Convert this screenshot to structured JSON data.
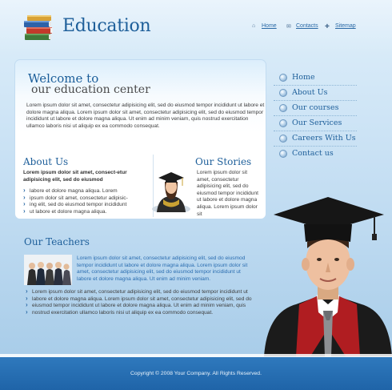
{
  "header": {
    "logo_text": "Education",
    "nav": [
      {
        "label": "Home",
        "icon": "home-icon"
      },
      {
        "label": "Contacts",
        "icon": "envelope-icon"
      },
      {
        "label": "Sitemap",
        "icon": "sitemap-icon"
      }
    ]
  },
  "welcome": {
    "title_line1": "Welcome to",
    "title_line2": "our education center",
    "paragraph": "Lorem ipsum dolor sit amet, consectetur adipisicing elit, sed do eiusmod tempor incididunt ut labore et dolore magna aliqua. Lorem ipsum dolor sit amet, consectetur adipisicing elit, sed do eiusmod tempor incididunt ut labore et dolore magna aliqua. Ut enim ad minim veniam, quis nostrud exercitation ullamco laboris nisi ut aliquip ex ea commodo consequat."
  },
  "about": {
    "heading": "About Us",
    "bold_text": "Lorem ipsum dolor sit amet, consect-etur adipisicing elit, sed do eiusmod",
    "items": [
      "labore et dolore magna aliqua. Lorem",
      "ipsum dolor sit amet, consectetur adipisic-",
      "ing elit, sed do eiusmod tempor incididunt",
      "ut labore et dolore magna aliqua."
    ]
  },
  "stories": {
    "heading": "Our Stories",
    "text": "Lorem ipsum dolor sit amet, consectetur adipisicing elit, sed do eiusmod tempor incididunt ut labore et dolore magna aliqua. Lorem ipsum dolor sit"
  },
  "sidenav": {
    "items": [
      {
        "label": "Home"
      },
      {
        "label": "About Us"
      },
      {
        "label": "Our courses"
      },
      {
        "label": "Our Services"
      },
      {
        "label": "Careers With Us"
      },
      {
        "label": "Contact us"
      }
    ]
  },
  "teachers": {
    "heading": "Our Teachers",
    "intro": "Lorem ipsum dolor sit amet, consectetur adipisicing elit, sed do eiusmod tempor incididunt ut labore et dolore magna aliqua. Lorem ipsum dolor sit amet, consectetur adipisicing elit, sed do eiusmod tempor incididunt ut labore et dolore magna aliqua. Ut enim ad minim veniam.",
    "items": [
      "Lorem ipsum dolor sit amet, consectetur adipisicing elit, sed do eiusmod tempor incididunt ut",
      "labore et dolore magna aliqua. Lorem ipsum dolor sit amet, consectetur adipisicing elit, sed do",
      "eiusmod tempor incididunt ut labore et dolore magna aliqua. Ut enim ad minim veniam, quis",
      "nostrud exercitation ullamco laboris nisi ut aliquip ex ea commodo consequat."
    ]
  },
  "footer": {
    "copyright": "Copyright © 2008 Your Company. All Rights Reserved."
  },
  "colors": {
    "accent": "#1e5f9a",
    "footer": "#2470b5",
    "link": "#2a6db0"
  }
}
